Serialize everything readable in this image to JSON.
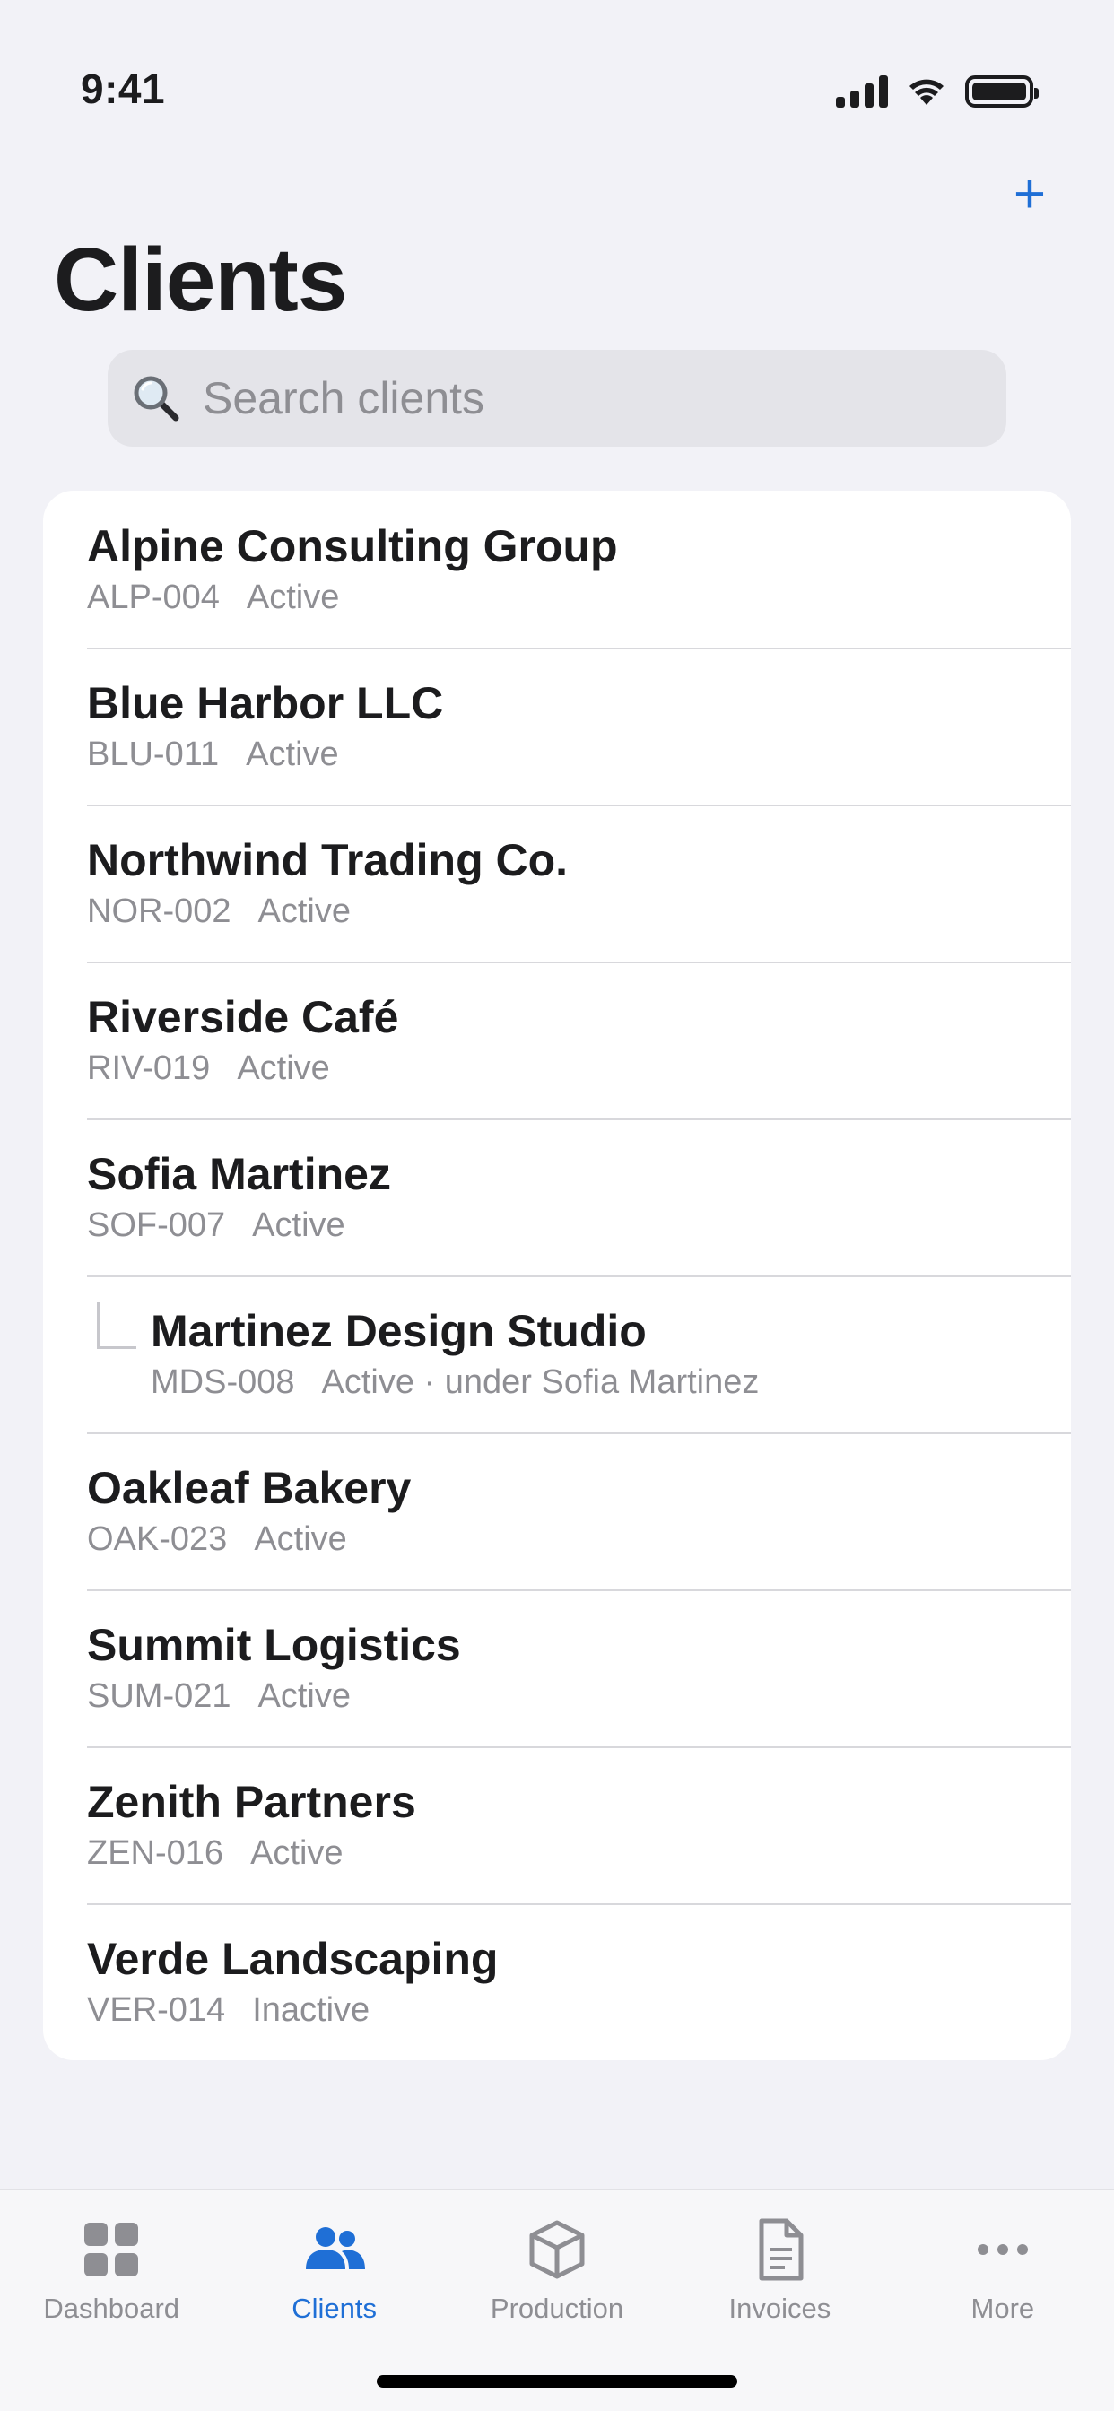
{
  "status_bar": {
    "time": "9:41"
  },
  "header": {
    "title": "Clients",
    "add_label": "+"
  },
  "search": {
    "placeholder": "Search clients"
  },
  "clients": [
    {
      "name": "Alpine Consulting Group",
      "code": "ALP-004",
      "status": "Active"
    },
    {
      "name": "Blue Harbor LLC",
      "code": "BLU-011",
      "status": "Active"
    },
    {
      "name": "Northwind Trading Co.",
      "code": "NOR-002",
      "status": "Active"
    },
    {
      "name": "Riverside Café",
      "code": "RIV-019",
      "status": "Active"
    },
    {
      "name": "Sofia Martinez",
      "code": "SOF-007",
      "status": "Active"
    },
    {
      "name": "Martinez Design Studio",
      "code": "MDS-008",
      "status": "Active · under Sofia Martinez"
    },
    {
      "name": "Oakleaf Bakery",
      "code": "OAK-023",
      "status": "Active"
    },
    {
      "name": "Summit Logistics",
      "code": "SUM-021",
      "status": "Active"
    },
    {
      "name": "Zenith Partners",
      "code": "ZEN-016",
      "status": "Active"
    },
    {
      "name": "Verde Landscaping",
      "code": "VER-014",
      "status": "Inactive"
    }
  ],
  "tabs": [
    {
      "label": "Dashboard",
      "icon": "grid-icon"
    },
    {
      "label": "Clients",
      "icon": "people-icon"
    },
    {
      "label": "Production",
      "icon": "box-icon"
    },
    {
      "label": "Invoices",
      "icon": "document-icon"
    },
    {
      "label": "More",
      "icon": "ellipsis-icon"
    }
  ],
  "colors": {
    "accent": "#1f6fd6",
    "background": "#f2f2f7",
    "secondary_text": "#8e8e93"
  }
}
